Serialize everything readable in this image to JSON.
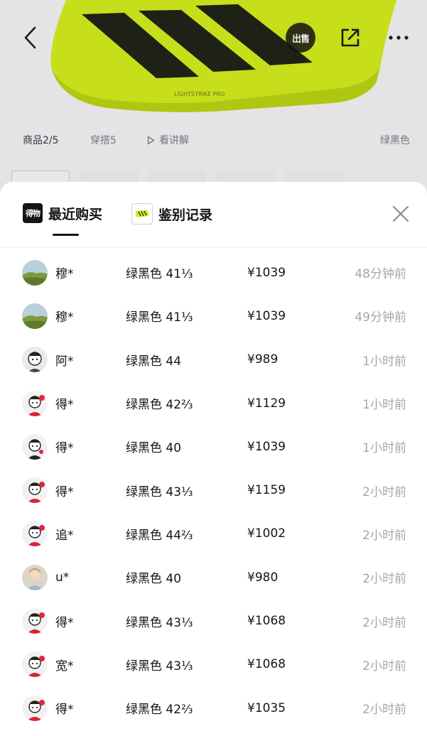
{
  "background": {
    "tabs": {
      "products": "商品2/5",
      "outfit": "穿搭5",
      "video": "看讲解",
      "color": "绿黑色"
    },
    "shoe_text": "LIGHTSTRIKE PRO",
    "sell_label": "出售"
  },
  "sheet": {
    "brand_logo_text": "得物",
    "tabs": [
      {
        "label": "最近购买",
        "active": true
      },
      {
        "label": "鉴别记录",
        "active": false
      }
    ]
  },
  "purchases": [
    {
      "user": "穆*",
      "spec": "绿黑色 41⅓",
      "price": "¥1039",
      "time": "48分钟前",
      "avatar": "landscape"
    },
    {
      "user": "穆*",
      "spec": "绿黑色 41⅓",
      "price": "¥1039",
      "time": "49分钟前",
      "avatar": "landscape"
    },
    {
      "user": "阿*",
      "spec": "绿黑色 44",
      "price": "¥989",
      "time": "1小时前",
      "avatar": "cartoon-gray"
    },
    {
      "user": "得*",
      "spec": "绿黑色 42⅔",
      "price": "¥1129",
      "time": "1小时前",
      "avatar": "cartoon-red"
    },
    {
      "user": "得*",
      "spec": "绿黑色 40",
      "price": "¥1039",
      "time": "1小时前",
      "avatar": "cartoon-black"
    },
    {
      "user": "得*",
      "spec": "绿黑色 43⅓",
      "price": "¥1159",
      "time": "2小时前",
      "avatar": "cartoon-red"
    },
    {
      "user": "追*",
      "spec": "绿黑色 44⅔",
      "price": "¥1002",
      "time": "2小时前",
      "avatar": "cartoon-red"
    },
    {
      "user": "u*",
      "spec": "绿黑色 40",
      "price": "¥980",
      "time": "2小时前",
      "avatar": "photo"
    },
    {
      "user": "得*",
      "spec": "绿黑色 43⅓",
      "price": "¥1068",
      "time": "2小时前",
      "avatar": "cartoon-red"
    },
    {
      "user": "宽*",
      "spec": "绿黑色 43⅓",
      "price": "¥1068",
      "time": "2小时前",
      "avatar": "cartoon-red"
    },
    {
      "user": "得*",
      "spec": "绿黑色 42⅔",
      "price": "¥1035",
      "time": "2小时前",
      "avatar": "cartoon-red"
    }
  ],
  "colors": {
    "shoe_green": "#d4ec1c",
    "text_primary": "#14151a",
    "text_secondary": "#a5a6ad"
  }
}
